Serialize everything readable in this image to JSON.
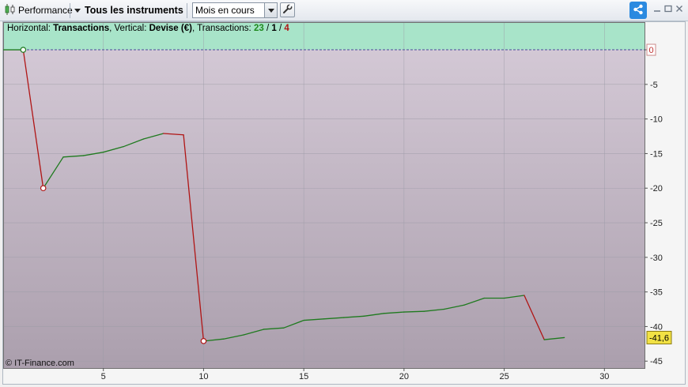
{
  "toolbar": {
    "performance_label": "Performance",
    "instruments_label": "Tous les instruments",
    "period_value": "Mois en cours"
  },
  "legend": {
    "h_prefix": "Horizontal: ",
    "h_value": "Transactions",
    "v_prefix": ", Vertical: ",
    "v_value": "Devise (€)",
    "t_prefix": ", Transactions: ",
    "t_green": "23",
    "t_sep1": " / ",
    "t_black": "1",
    "t_sep2": " / ",
    "t_red": "4"
  },
  "copyright": "© IT-Finance.com",
  "last_value_label": "-41,6",
  "zero_label": "0",
  "colors": {
    "gain": "#1f7a1f",
    "loss": "#b01515",
    "profit_zone": "#a8e4c9",
    "loss_zone_top": "#d3c8d5",
    "loss_zone_bottom": "#ab9fad",
    "last_value_bg": "#f2e244",
    "accent": "#2b8ae0"
  },
  "icons": {
    "performance": "candlestick-icon",
    "instruments": "triangle-down-icon",
    "period": "dropdown-arrow-icon",
    "settings": "wrench-icon",
    "share": "share-icon",
    "minimize": "minimize-icon",
    "maximize": "maximize-icon",
    "close": "close-icon"
  },
  "chart_data": {
    "type": "line",
    "xlabel": "Transactions",
    "ylabel": "Devise (€)",
    "xlim": [
      0,
      32
    ],
    "ylim": [
      -46,
      4
    ],
    "xticks": [
      5,
      10,
      15,
      20,
      25,
      30
    ],
    "yticks": [
      0,
      -5,
      -10,
      -15,
      -20,
      -25,
      -30,
      -35,
      -40,
      -45
    ],
    "xtick_labels": [
      "5",
      "10",
      "15",
      "20",
      "25",
      "30"
    ],
    "ytick_labels": [
      "0",
      "-5",
      "-10",
      "-15",
      "-20",
      "-25",
      "-30",
      "-35",
      "-40",
      "-45"
    ],
    "grid": true,
    "x": [
      0,
      1,
      2,
      3,
      4,
      5,
      6,
      7,
      8,
      9,
      10,
      11,
      12,
      13,
      14,
      15,
      16,
      17,
      18,
      19,
      20,
      21,
      22,
      23,
      24,
      25,
      26,
      27,
      28
    ],
    "y": [
      0,
      0,
      -20,
      -15.5,
      -15.3,
      -14.8,
      -14,
      -12.9,
      -12.1,
      -12.3,
      -42.1,
      -41.8,
      -41.2,
      -40.4,
      -40.2,
      -39.1,
      -38.9,
      -38.7,
      -38.5,
      -38.1,
      -37.9,
      -37.8,
      -37.5,
      -36.9,
      -35.9,
      -35.9,
      -35.5,
      -41.9,
      -41.6
    ],
    "segment_colors": [
      "gain",
      "loss",
      "gain",
      "gain",
      "gain",
      "gain",
      "gain",
      "gain",
      "loss",
      "loss",
      "gain",
      "gain",
      "gain",
      "gain",
      "gain",
      "gain",
      "gain",
      "gain",
      "gain",
      "gain",
      "gain",
      "gain",
      "gain",
      "gain",
      "gain",
      "gain",
      "loss",
      "gain"
    ],
    "markers": [
      {
        "x": 1,
        "y": 0,
        "kind": "peak"
      },
      {
        "x": 2,
        "y": -20,
        "kind": "trough"
      },
      {
        "x": 10,
        "y": -42.1,
        "kind": "trough"
      }
    ],
    "last_value": -41.6
  }
}
